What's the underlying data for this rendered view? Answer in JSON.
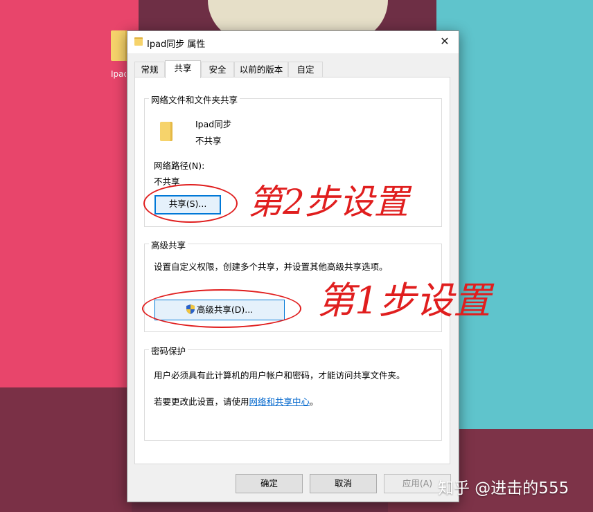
{
  "desktop": {
    "icon_label": "Ipad"
  },
  "dialog": {
    "title": "Ipad同步 属性",
    "close_glyph": "✕",
    "tabs": [
      "常规",
      "共享",
      "安全",
      "以前的版本",
      "自定义"
    ],
    "active_tab": "共享",
    "network_group": {
      "title": "网络文件和文件夹共享",
      "folder_name": "Ipad同步",
      "folder_status": "不共享",
      "path_label": "网络路径(N):",
      "path_value": "不共享",
      "share_button": "共享(S)..."
    },
    "advanced_group": {
      "title": "高级共享",
      "description": "设置自定义权限，创建多个共享，并设置其他高级共享选项。",
      "button": "高级共享(D)..."
    },
    "password_group": {
      "title": "密码保护",
      "line1": "用户必须具有此计算机的用户帐户和密码，才能访问共享文件夹。",
      "line2_prefix": "若要更改此设置，请使用",
      "line2_link": "网络和共享中心",
      "line2_suffix": "。"
    },
    "footer": {
      "ok": "确定",
      "cancel": "取消",
      "apply": "应用(A)"
    }
  },
  "annotations": {
    "step2": "第2步设置",
    "step1": "第1步设置",
    "color": "#e01e1e"
  },
  "watermark": "知乎 @进击的555",
  "icons": {
    "folder": "folder-icon",
    "shield": "uac-shield-icon",
    "close": "close-icon"
  }
}
